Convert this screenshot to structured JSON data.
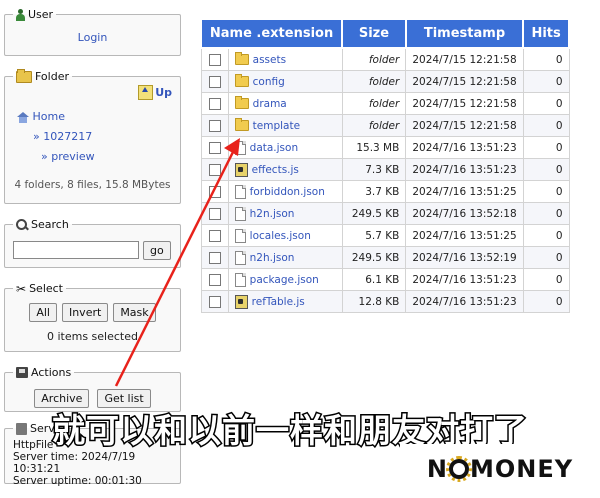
{
  "sidebar": {
    "user": {
      "legend": "User",
      "login": "Login"
    },
    "folder": {
      "legend": "Folder",
      "up": "Up",
      "home": "Home",
      "crumb1": "» 1027217",
      "crumb2": "» preview",
      "summary": "4 folders, 8 files, 15.8 MBytes"
    },
    "search": {
      "legend": "Search",
      "value": "",
      "go": "go"
    },
    "select": {
      "legend": "Select",
      "all": "All",
      "invert": "Invert",
      "mask": "Mask",
      "status": "0 items selected"
    },
    "actions": {
      "legend": "Actions",
      "archive": "Archive",
      "getlist": "Get list"
    },
    "server": {
      "legend": "Serv",
      "link": "HttpFile",
      "time": "Server time: 2024/7/19 10:31:21",
      "uptime": "Server uptime: 00:01:30"
    }
  },
  "table": {
    "headers": {
      "name": "Name .extension",
      "size": "Size",
      "timestamp": "Timestamp",
      "hits": "Hits"
    },
    "rows": [
      {
        "name": "assets",
        "size": "folder",
        "timestamp": "2024/7/15 12:21:58",
        "hits": "0",
        "kind": "folder"
      },
      {
        "name": "config",
        "size": "folder",
        "timestamp": "2024/7/15 12:21:58",
        "hits": "0",
        "kind": "folder"
      },
      {
        "name": "drama",
        "size": "folder",
        "timestamp": "2024/7/15 12:21:58",
        "hits": "0",
        "kind": "folder"
      },
      {
        "name": "template",
        "size": "folder",
        "timestamp": "2024/7/15 12:21:58",
        "hits": "0",
        "kind": "folder"
      },
      {
        "name": "data.json",
        "size": "15.3 MB",
        "timestamp": "2024/7/16 13:51:23",
        "hits": "0",
        "kind": "file"
      },
      {
        "name": "effects.js",
        "size": "7.3 KB",
        "timestamp": "2024/7/16 13:51:23",
        "hits": "0",
        "kind": "script"
      },
      {
        "name": "forbiddon.json",
        "size": "3.7 KB",
        "timestamp": "2024/7/16 13:51:25",
        "hits": "0",
        "kind": "file"
      },
      {
        "name": "h2n.json",
        "size": "249.5 KB",
        "timestamp": "2024/7/16 13:52:18",
        "hits": "0",
        "kind": "file"
      },
      {
        "name": "locales.json",
        "size": "5.7 KB",
        "timestamp": "2024/7/16 13:51:25",
        "hits": "0",
        "kind": "file"
      },
      {
        "name": "n2h.json",
        "size": "249.5 KB",
        "timestamp": "2024/7/16 13:52:19",
        "hits": "0",
        "kind": "file"
      },
      {
        "name": "package.json",
        "size": "6.1 KB",
        "timestamp": "2024/7/16 13:51:23",
        "hits": "0",
        "kind": "file"
      },
      {
        "name": "refTable.js",
        "size": "12.8 KB",
        "timestamp": "2024/7/16 13:51:23",
        "hits": "0",
        "kind": "script"
      }
    ]
  },
  "overlay": {
    "caption": "就可以和以前一样和朋友对打了",
    "logo_left": "N",
    "logo_right": "MONEY",
    "arrow_color": "#e8221b"
  },
  "colors": {
    "header_bg": "#3a6fd6",
    "link": "#3355bb"
  }
}
